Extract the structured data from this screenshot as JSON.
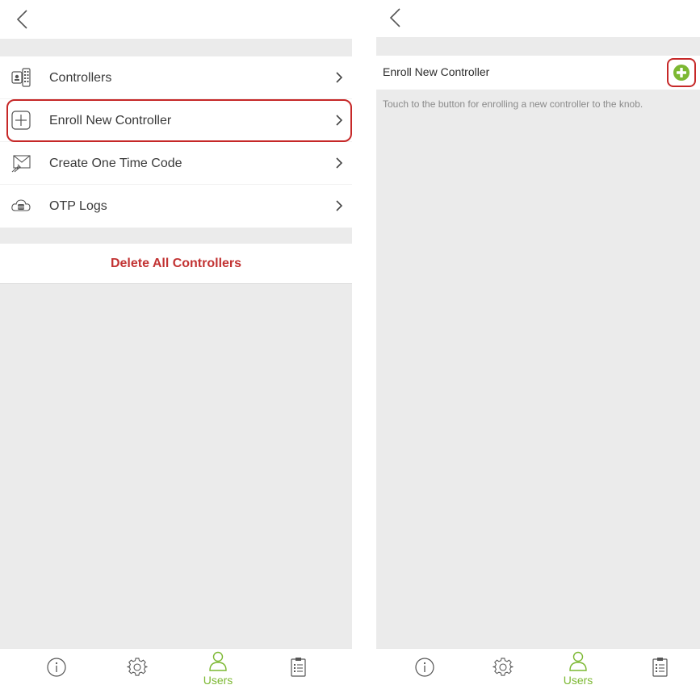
{
  "left": {
    "menu": [
      {
        "id": "controllers",
        "label": "Controllers",
        "icon": "controllers-device-icon"
      },
      {
        "id": "enroll",
        "label": "Enroll New Controller",
        "icon": "plus-square-icon"
      },
      {
        "id": "otc",
        "label": "Create One Time Code",
        "icon": "send-envelope-icon"
      },
      {
        "id": "otp",
        "label": "OTP Logs",
        "icon": "cloud-database-icon"
      }
    ],
    "delete_label": "Delete All Controllers"
  },
  "right": {
    "title": "Enroll New Controller",
    "hint": "Touch to the button for enrolling a new controller to the knob."
  },
  "tabbar": {
    "users_label": "Users",
    "tabs": [
      "info-icon",
      "settings-gear-icon",
      "users-icon",
      "clipboard-list-icon"
    ]
  },
  "colors": {
    "accent_green": "#7cb832",
    "danger_red": "#c23333",
    "highlight_red": "#c62828",
    "background_gray": "#ebebeb",
    "text_dark": "#3a3a3a",
    "hint_gray": "#8a8a8a"
  }
}
